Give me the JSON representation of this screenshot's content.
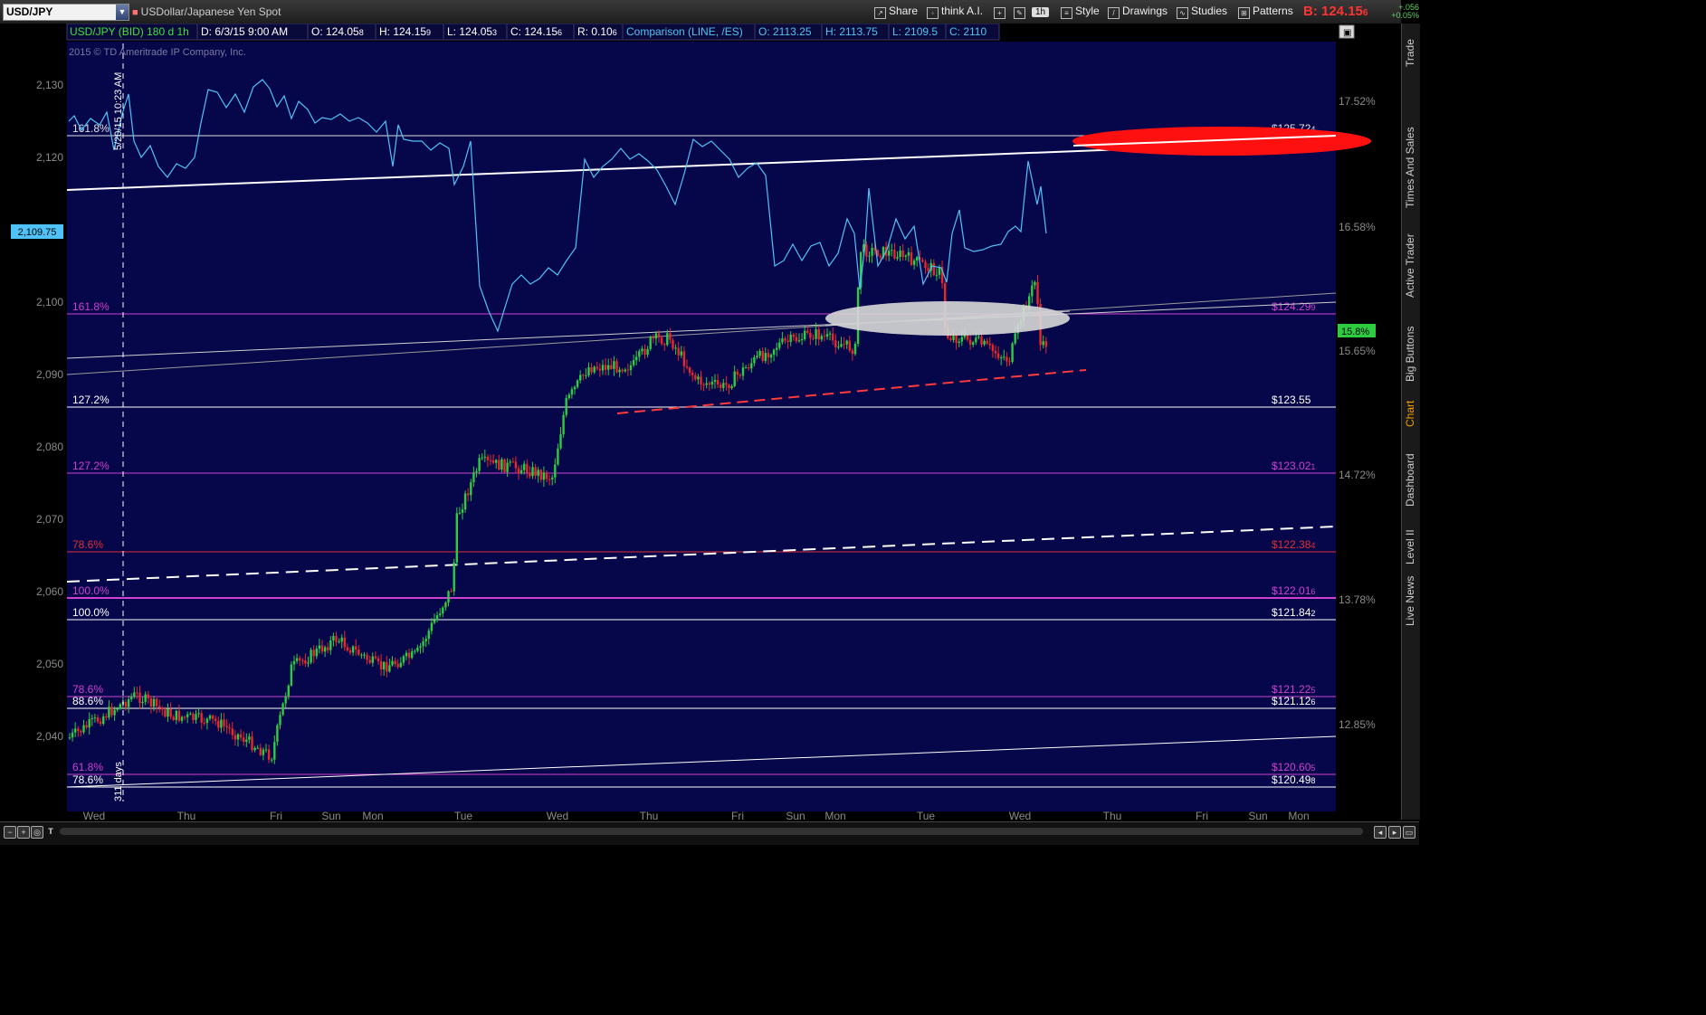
{
  "toolbar": {
    "symbol": "USD/JPY",
    "description": "USDollar/Japanese Yen Spot",
    "buttons": [
      "Share",
      "think A.I.",
      "Style",
      "Drawings",
      "Studies",
      "Patterns"
    ],
    "interval": "1h",
    "bid_label": "B:",
    "bid_price": "124.15",
    "bid_price_small": "6",
    "change_abs": "+.056",
    "change_pct": "+0.05%"
  },
  "side_tabs": [
    "Trade",
    "Times And Sales",
    "Active Trader",
    "Big Buttons",
    "Chart",
    "Dashboard",
    "Level II",
    "Live News"
  ],
  "active_tab": "Chart",
  "info_bar": {
    "symbol_label": "USD/JPY (BID) 180 d 1h",
    "date": "D: 6/3/15 9:00 AM",
    "open": "O: 124.05",
    "open_small": "8",
    "high": "H: 124.15",
    "high_small": "9",
    "low": "L: 124.05",
    "low_small": "3",
    "close": "C: 124.15",
    "close_small": "6",
    "range": "R: 0.10",
    "range_small": "6",
    "comparison": "Comparison (LINE, /ES)",
    "c_open": "O: 2113.25",
    "c_high": "H: 2113.75",
    "c_low": "L: 2109.5",
    "c_close": "C: 2110"
  },
  "copyright": "2015 © TD Ameritrade IP Company, Inc.",
  "left_axis": [
    "2,130",
    "2,120",
    "2,110",
    "2,100",
    "2,090",
    "2,080",
    "2,070",
    "2,060",
    "2,050",
    "2,040"
  ],
  "left_axis_marker": "2,109.75",
  "right_axis": [
    "17.52%",
    "16.58%",
    "15.65%",
    "14.72%",
    "13.78%",
    "12.85%"
  ],
  "right_axis_marker": "15.8%",
  "x_axis": [
    "Wed",
    "Thu",
    "Fri",
    "Sun",
    "Mon",
    "Tue",
    "Wed",
    "Thu",
    "Fri",
    "Sun",
    "Mon",
    "Tue",
    "Wed",
    "Thu",
    "Fri",
    "Sun",
    "Mon"
  ],
  "vertical_annotations": {
    "date": "5/20/15 10:23 AM",
    "days": "311 days"
  },
  "fib_levels": [
    {
      "label": "161.8%",
      "price": "$125.72",
      "price_small": "4",
      "color": "#e0e0e0"
    },
    {
      "label": "161.8%",
      "price": "$124.29",
      "price_small": "9",
      "color": "#d040d0"
    },
    {
      "label": "127.2%",
      "price": "$123.55",
      "price_small": "",
      "color": "#ffffff"
    },
    {
      "label": "127.2%",
      "price": "$123.02",
      "price_small": "1",
      "color": "#d040d0"
    },
    {
      "label": "78.6%",
      "price": "$122.38",
      "price_small": "4",
      "color": "#e03030"
    },
    {
      "label": "100.0%",
      "price": "$122.01",
      "price_small": "6",
      "color": "#d040d0"
    },
    {
      "label": "100.0%",
      "price": "$121.84",
      "price_small": "2",
      "color": "#ffffff"
    },
    {
      "label": "78.6%",
      "price": "$121.22",
      "price_small": "5",
      "color": "#d040d0"
    },
    {
      "label": "88.6%",
      "price": "$121.12",
      "price_small": "6",
      "color": "#ffffff"
    },
    {
      "label": "61.8%",
      "price": "$120.60",
      "price_small": "5",
      "color": "#d040d0"
    },
    {
      "label": "78.6%",
      "price": "$120.49",
      "price_small": "8",
      "color": "#ffffff"
    }
  ],
  "colors": {
    "background": "#06064a",
    "candle_up": "#2ecc40",
    "candle_down": "#e8282a",
    "comparison_line": "#4fc3f7",
    "fib_magenta": "#d040d0",
    "fib_white": "#ffffff",
    "fib_red": "#e03030",
    "highlight_red": "#ff1010",
    "highlight_gray": "#d8d8d8"
  }
}
